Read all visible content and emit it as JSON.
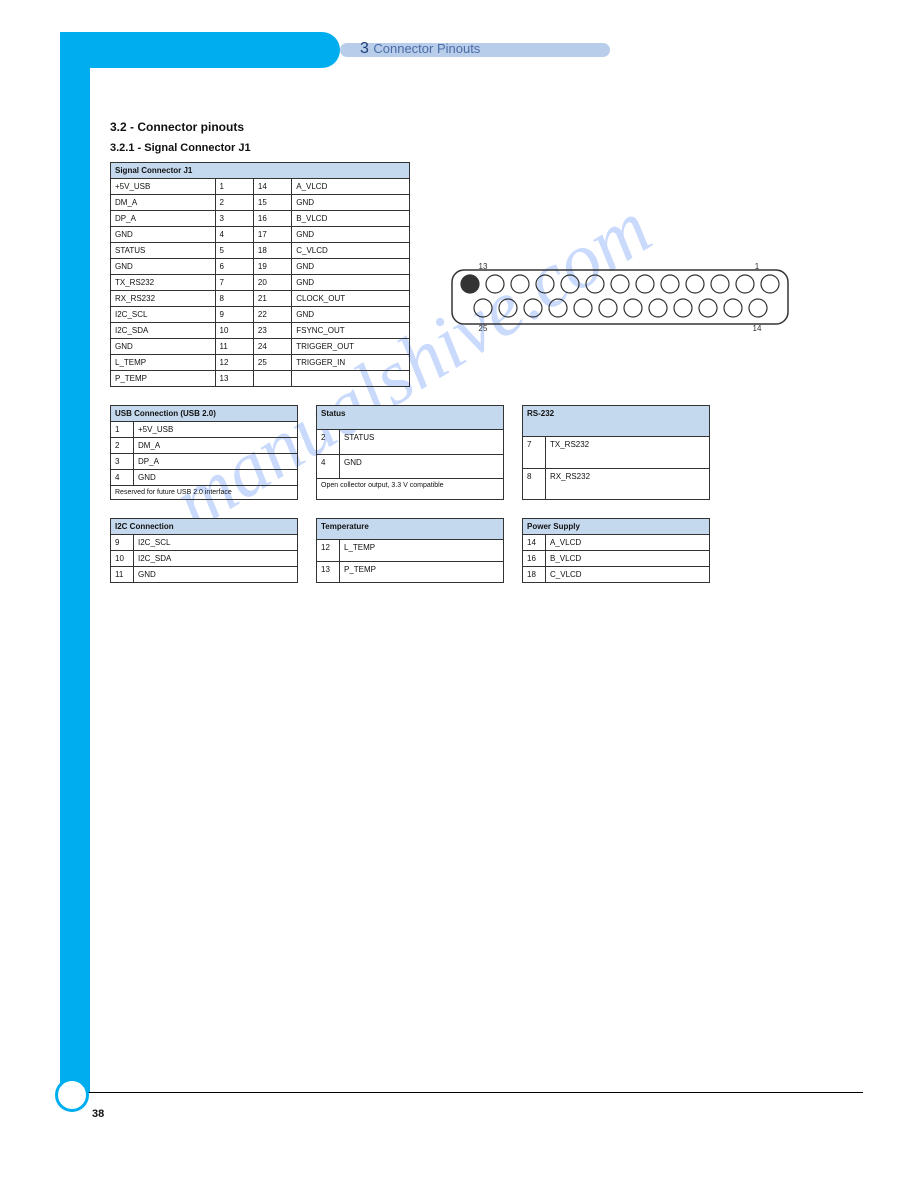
{
  "chapter": {
    "num": "3",
    "title": "Connector Pinouts"
  },
  "page_num": "38",
  "section_title": "3.2 - Connector pinouts",
  "section_sub": "3.2.1 - Signal Connector J1",
  "watermark": "manualshive.com",
  "main_table": {
    "header": "Signal Connector J1",
    "rows": [
      [
        "+5V_USB",
        "1",
        "14",
        "A_VLCD"
      ],
      [
        "DM_A",
        "2",
        "15",
        "GND"
      ],
      [
        "DP_A",
        "3",
        "16",
        "B_VLCD"
      ],
      [
        "GND",
        "4",
        "17",
        "GND"
      ],
      [
        "STATUS",
        "5",
        "18",
        "C_VLCD"
      ],
      [
        "GND",
        "6",
        "19",
        "GND"
      ],
      [
        "TX_RS232",
        "7",
        "20",
        "GND"
      ],
      [
        "RX_RS232",
        "8",
        "21",
        "CLOCK_OUT"
      ],
      [
        "I2C_SCL",
        "9",
        "22",
        "GND"
      ],
      [
        "I2C_SDA",
        "10",
        "23",
        "FSYNC_OUT"
      ],
      [
        "GND",
        "11",
        "24",
        "TRIGGER_OUT"
      ],
      [
        "L_TEMP",
        "12",
        "25",
        "TRIGGER_IN"
      ],
      [
        "P_TEMP",
        "13",
        "",
        ""
      ]
    ]
  },
  "small_tables": [
    {
      "title": "USB Connection (USB 2.0)",
      "rows": [
        [
          "1",
          "+5V_USB"
        ],
        [
          "2",
          "DM_A"
        ],
        [
          "3",
          "DP_A"
        ],
        [
          "4",
          "GND"
        ]
      ],
      "foot": "Reserved for future USB 2.0 interface"
    },
    {
      "title": "Status",
      "rows": [
        [
          "2",
          "STATUS"
        ],
        [
          "4",
          "GND"
        ]
      ],
      "foot": "Open collector output, 3.3 V compatible"
    },
    {
      "title": "RS-232",
      "rows": [
        [
          "7",
          "TX_RS232"
        ],
        [
          "8",
          "RX_RS232"
        ]
      ],
      "foot": ""
    },
    {
      "title": "I2C Connection",
      "rows": [
        [
          "9",
          "I2C_SCL"
        ],
        [
          "10",
          "I2C_SDA"
        ],
        [
          "11",
          "GND"
        ]
      ],
      "foot": ""
    },
    {
      "title": "Temperature",
      "rows": [
        [
          "12",
          "L_TEMP"
        ],
        [
          "13",
          "P_TEMP"
        ]
      ],
      "foot": ""
    },
    {
      "title": "Power Supply",
      "rows": [
        [
          "14",
          "A_VLCD"
        ],
        [
          "16",
          "B_VLCD"
        ],
        [
          "18",
          "C_VLCD"
        ]
      ],
      "foot": ""
    }
  ],
  "conn": {
    "top_labels": [
      "13",
      "1"
    ],
    "bot_labels": [
      "25",
      "14"
    ]
  }
}
